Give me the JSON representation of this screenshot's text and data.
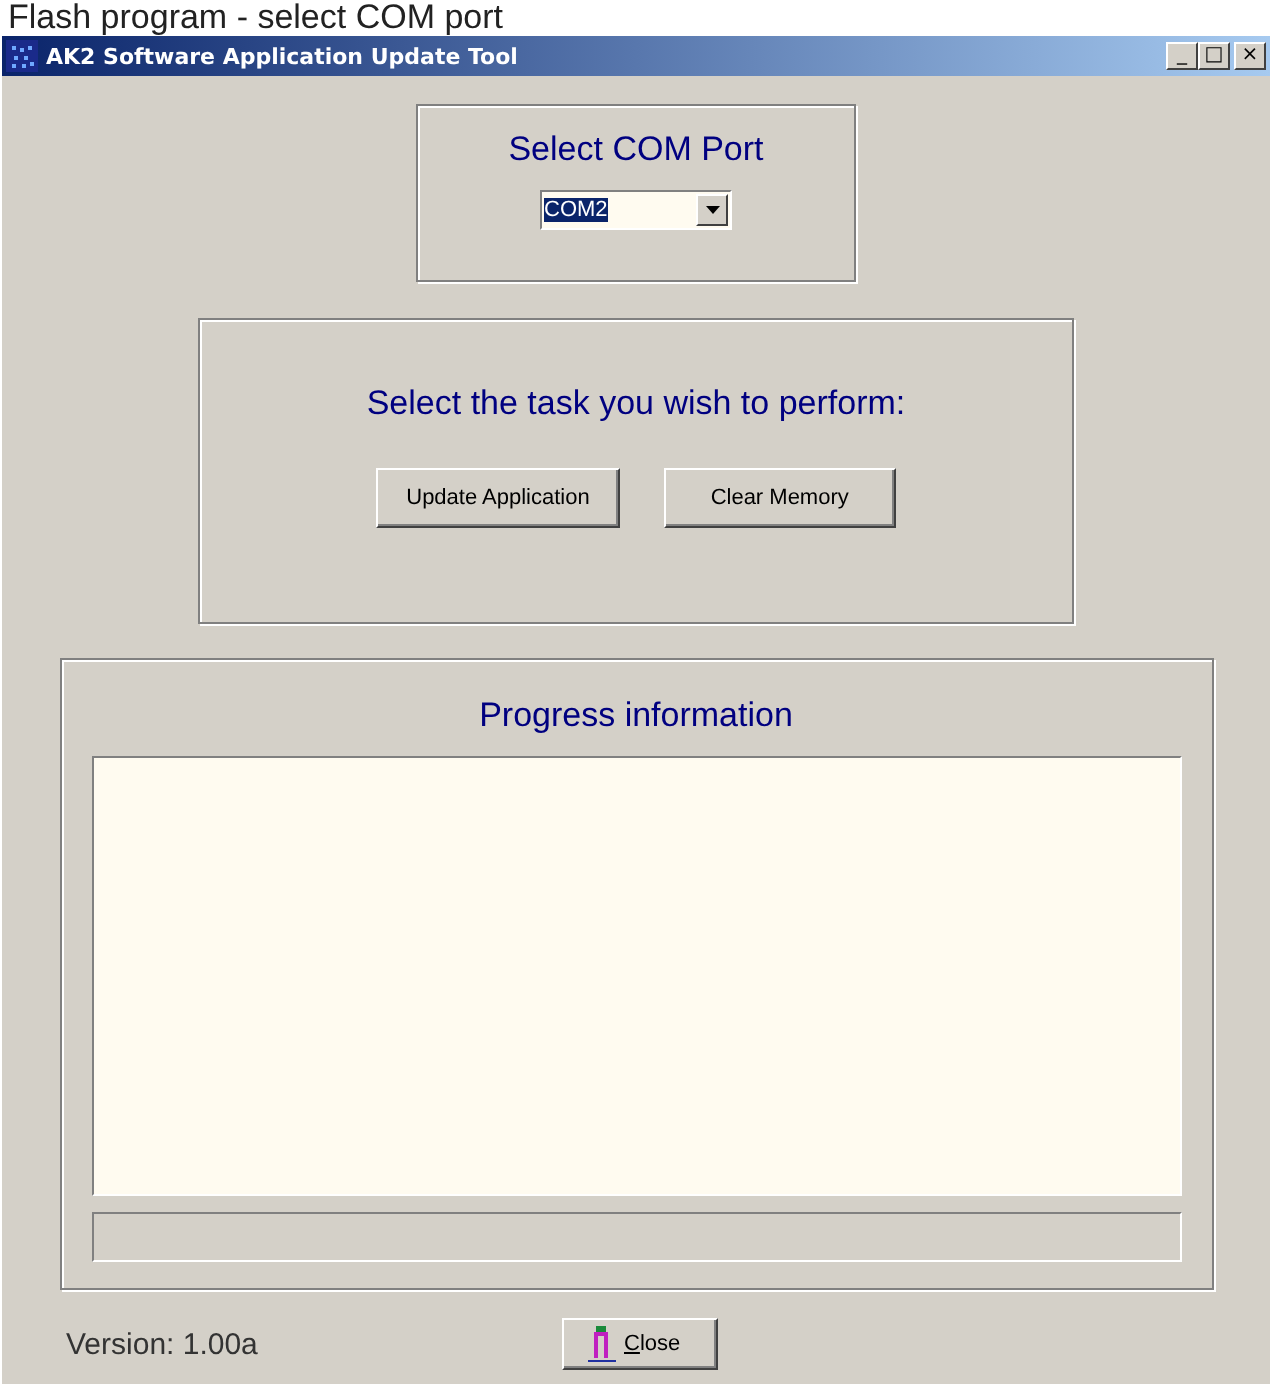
{
  "caption": "Flash program - select COM port",
  "window": {
    "title": "AK2 Software Application Update Tool",
    "controls": [
      "_",
      "□",
      "×"
    ]
  },
  "com_port": {
    "title": "Select COM Port",
    "value": "COM2"
  },
  "task": {
    "title": "Select the task you wish to perform:",
    "buttons": [
      "Update Application",
      "Clear Memory"
    ]
  },
  "progress": {
    "title": "Progress information"
  },
  "version": "Version: 1.00a",
  "close_button": "Close"
}
